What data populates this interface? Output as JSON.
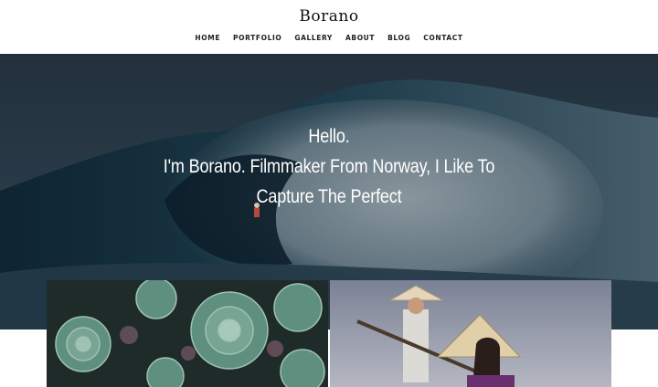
{
  "brand": {
    "title": "Borano"
  },
  "nav": {
    "items": [
      "HOME",
      "PORTFOLIO",
      "GALLERY",
      "ABOUT",
      "BLOG",
      "CONTACT"
    ]
  },
  "hero": {
    "line1": "Hello.",
    "line2": "I'm Borano. Filmmaker From Norway, I Like To",
    "line3": "Capture The Perfect",
    "image": "ocean-wave-surfer-photo"
  },
  "gallery": {
    "left_image": "succulent-plants-photo",
    "right_image": "woman-conical-hat-photo"
  },
  "colors": {
    "hero_overlay": "#1b2733",
    "text_dark": "#111111",
    "text_light": "#ffffff"
  }
}
